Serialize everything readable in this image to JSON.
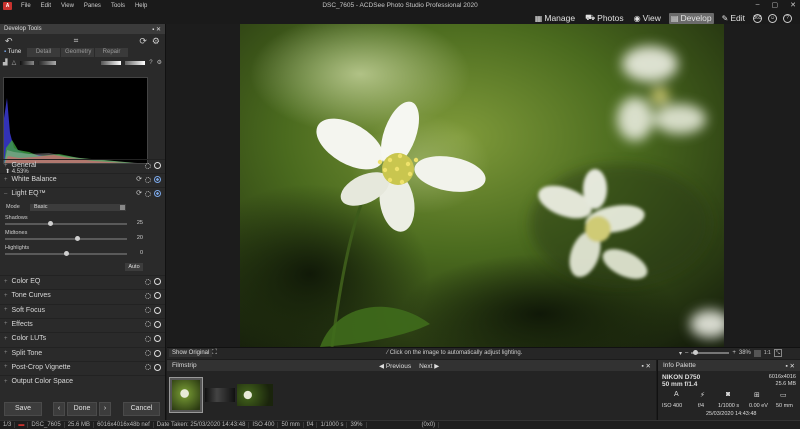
{
  "window": {
    "title": "DSC_7605 - ACDSee Photo Studio Professional 2020",
    "menu": [
      "File",
      "Edit",
      "View",
      "Panes",
      "Tools",
      "Help"
    ],
    "controls": [
      "–",
      "▢",
      "✕"
    ]
  },
  "modes": [
    {
      "label": "Manage",
      "icon": "grid-icon",
      "glyph": "▦"
    },
    {
      "label": "Photos",
      "icon": "car-icon",
      "glyph": "⛟"
    },
    {
      "label": "View",
      "icon": "eye-icon",
      "glyph": "◉"
    },
    {
      "label": "Develop",
      "icon": "sliders-icon",
      "glyph": "▤"
    },
    {
      "label": "Edit",
      "icon": "brush-icon",
      "glyph": "✎"
    }
  ],
  "mode_icons": [
    "365",
    "user",
    "?"
  ],
  "left_panel": {
    "title": "Develop Tools",
    "tabs": [
      "Tune",
      "Detail",
      "Geometry",
      "Repair"
    ],
    "histogram_percent": "4.53%",
    "sections_top": [
      {
        "label": "General"
      },
      {
        "label": "White Balance"
      },
      {
        "label": "Light EQ™"
      }
    ],
    "light_eq": {
      "mode_label": "Mode",
      "mode_value": "Basic",
      "shadows_label": "Shadows",
      "shadows_value": "25",
      "shadows_level": 0.37,
      "midtones_label": "Midtones",
      "midtones_value": "20",
      "midtones_level": 0.6,
      "highlights_label": "Highlights",
      "highlights_value": "0",
      "highlights_level": 0.5,
      "auto_label": "Auto"
    },
    "sections_bottom": [
      {
        "label": "Color EQ"
      },
      {
        "label": "Tone Curves"
      },
      {
        "label": "Soft Focus"
      },
      {
        "label": "Effects"
      },
      {
        "label": "Color LUTs"
      },
      {
        "label": "Split Tone"
      },
      {
        "label": "Post-Crop Vignette"
      },
      {
        "label": "Output Color Space"
      }
    ],
    "buttons": {
      "save": "Save",
      "done": "Done",
      "cancel": "Cancel"
    }
  },
  "viewbar": {
    "show_original": "Show Original",
    "hint": "Click on the image to automatically adjust lighting.",
    "zoom": "38%",
    "ratio": "1:1"
  },
  "filmstrip": {
    "title": "Filmstrip",
    "previous": "Previous",
    "next": "Next"
  },
  "info_palette": {
    "title": "Info Palette",
    "camera": "NIKON D750",
    "lens": "50 mm f/1.4",
    "dimensions": "6016x4016",
    "size": "25.6 MB",
    "iso": "ISO 400",
    "aperture": "f/4",
    "shutter": "1/1000 s",
    "ev": "0.00 eV",
    "focal": "50 mm",
    "datetime": "25/03/2020 14:43:48"
  },
  "statusbar": {
    "index": "1/3",
    "filename": "DSC_7605",
    "filesize": "25.6 MB",
    "dims": "6016x4016x48b nef",
    "date_taken": "Date Taken: 25/03/2020 14:43:48",
    "iso": "ISO 400",
    "focal": "50 mm",
    "aperture": "f/4",
    "shutter": "1/1000 s",
    "zoom": "39%",
    "coords": "(0x0)"
  },
  "colors": {
    "accent": "#7aa7e8",
    "brand": "#c8322e"
  }
}
